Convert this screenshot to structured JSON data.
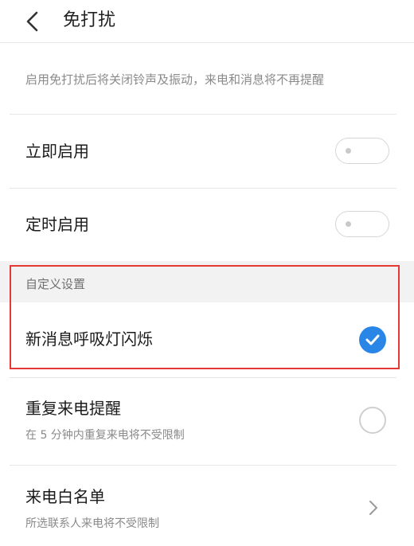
{
  "header": {
    "title": "免打扰",
    "back_icon": "chevron-left-icon"
  },
  "description": "启用免打扰后将关闭铃声及振动，来电和消息将不再提醒",
  "items": {
    "immediate": {
      "title": "立即启用",
      "enabled": false
    },
    "scheduled": {
      "title": "定时启用",
      "enabled": false
    }
  },
  "custom_section": {
    "label": "自定义设置",
    "breathing_light": {
      "title": "新消息呼吸灯闪烁",
      "checked": true
    },
    "repeat_call": {
      "title": "重复来电提醒",
      "subtitle": "在 5 分钟内重复来电将不受限制",
      "checked": false
    },
    "whitelist": {
      "title": "来电白名单",
      "subtitle": "所选联系人来电将不受限制"
    }
  },
  "colors": {
    "accent": "#2a86e6",
    "highlight_border": "#e53935"
  }
}
